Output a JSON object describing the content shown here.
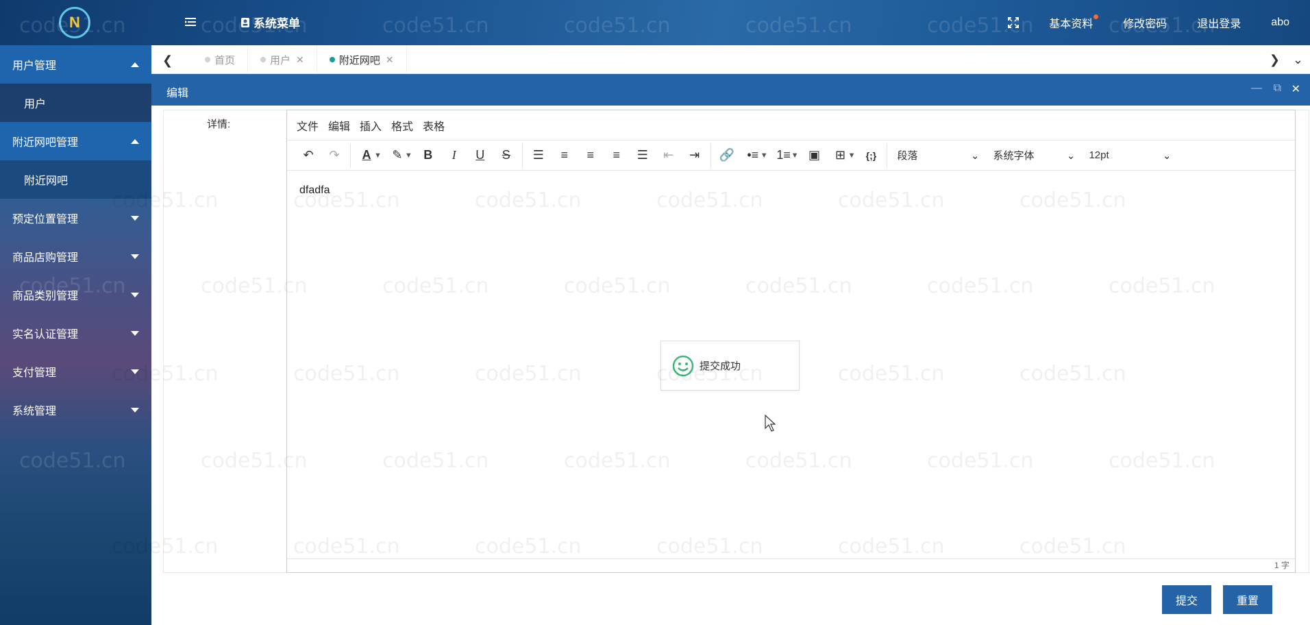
{
  "header": {
    "logo_text": "N",
    "system_menu": "系统菜单",
    "items": [
      "基本资料",
      "修改密码",
      "退出登录",
      "abo"
    ]
  },
  "sidebar": {
    "items": [
      {
        "label": "用户管理",
        "type": "group",
        "expanded": true,
        "active": true
      },
      {
        "label": "用户",
        "type": "sub"
      },
      {
        "label": "附近网吧管理",
        "type": "group",
        "expanded": true,
        "active": true
      },
      {
        "label": "附近网吧",
        "type": "sub",
        "active": true
      },
      {
        "label": "预定位置管理",
        "type": "group"
      },
      {
        "label": "商品店购管理",
        "type": "group"
      },
      {
        "label": "商品类别管理",
        "type": "group"
      },
      {
        "label": "实名认证管理",
        "type": "group"
      },
      {
        "label": "支付管理",
        "type": "group"
      },
      {
        "label": "系统管理",
        "type": "group"
      }
    ]
  },
  "tabs": [
    {
      "label": "首页",
      "closable": false,
      "active": false
    },
    {
      "label": "用户",
      "closable": true,
      "active": false
    },
    {
      "label": "附近网吧",
      "closable": true,
      "active": true
    }
  ],
  "window": {
    "title": "编辑"
  },
  "form": {
    "label": "详情:"
  },
  "editor": {
    "menu": [
      "文件",
      "编辑",
      "插入",
      "格式",
      "表格"
    ],
    "block_format": "段落",
    "font_family": "系统字体",
    "font_size": "12pt",
    "content": "dfadfa",
    "word_count": "1 字"
  },
  "toast": {
    "message": "提交成功"
  },
  "buttons": {
    "submit": "提交",
    "reset": "重置"
  },
  "watermark": "code51.cn",
  "colors": {
    "primary": "#2563a8",
    "active_tab_dot": "#1b9a9a",
    "badge": "#ff6633"
  }
}
